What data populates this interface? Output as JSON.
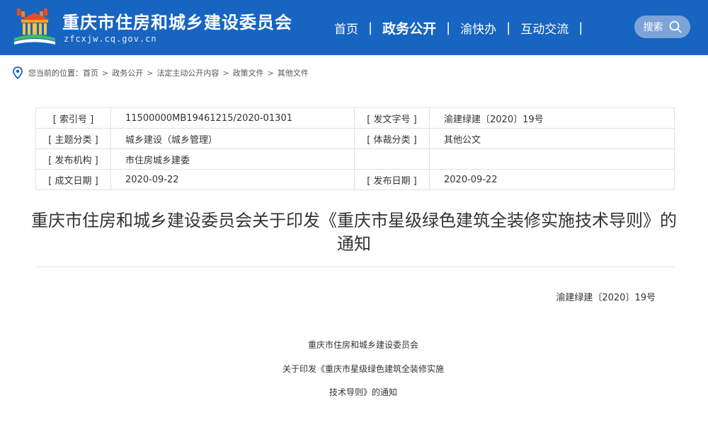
{
  "header": {
    "site_title": "重庆市住房和城乡建设委员会",
    "site_domain": "zfcxjw.cq.gov.cn",
    "nav": [
      {
        "label": "首页",
        "active": false
      },
      {
        "label": "政务公开",
        "active": true
      },
      {
        "label": "渝快办",
        "active": false
      },
      {
        "label": "互动交流",
        "active": false
      }
    ],
    "search_label": "搜索",
    "colors": {
      "brand": "#1765c1",
      "search_bg": "#7da4d8"
    }
  },
  "breadcrumb": {
    "prefix": "您当前的位置：",
    "items": [
      "首页",
      "政务公开",
      "法定主动公开内容",
      "政策文件",
      "其他文件"
    ],
    "separator": ">"
  },
  "info": {
    "rows": [
      {
        "label1": "[ 索引号 ]",
        "value1": "11500000MB19461215/2020-01301",
        "label2": "[ 发文字号 ]",
        "value2": "渝建绿建〔2020〕19号"
      },
      {
        "label1": "[ 主题分类 ]",
        "value1": "城乡建设（城乡管理）",
        "label2": "[ 体裁分类 ]",
        "value2": "其他公文"
      },
      {
        "label1": "[ 发布机构 ]",
        "value1": "市住房城乡建委",
        "label2": "",
        "value2": ""
      },
      {
        "label1": "[ 成文日期 ]",
        "value1": "2020-09-22",
        "label2": "[ 发布日期 ]",
        "value2": "2020-09-22"
      }
    ]
  },
  "document": {
    "title_line1": "重庆市住房和城乡建设委员会关于印发《重庆市星级绿色建筑全装修实施技术导则》的",
    "title_line2": "通知",
    "doc_number": "渝建绿建〔2020〕19号",
    "body_lines": [
      "重庆市住房和城乡建设委员会",
      "关于印发《重庆市星级绿色建筑全装修实施",
      "技术导则》的通知"
    ]
  }
}
